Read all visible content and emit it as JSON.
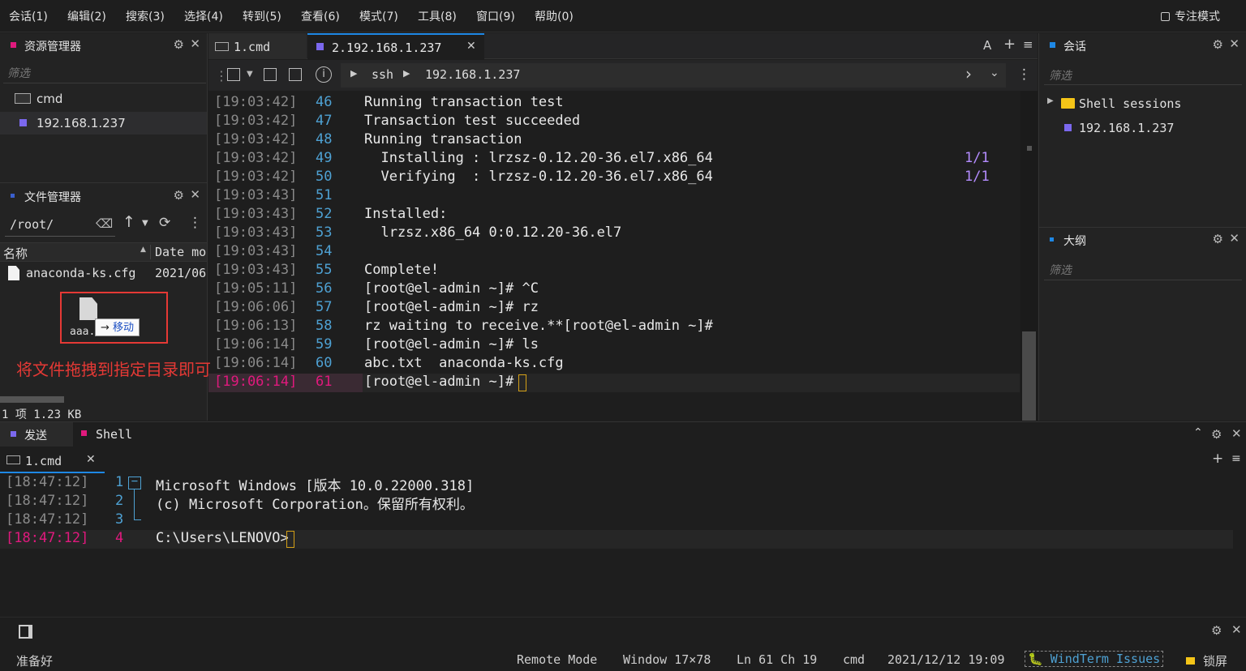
{
  "menu": [
    "会话(1)",
    "编辑(2)",
    "搜索(3)",
    "选择(4)",
    "转到(5)",
    "查看(6)",
    "模式(7)",
    "工具(8)",
    "窗口(9)",
    "帮助(0)"
  ],
  "focus_mode": "专注模式",
  "resource_panel": {
    "title": "资源管理器",
    "filter": "筛选",
    "items": [
      "cmd",
      "192.168.1.237"
    ]
  },
  "file_panel": {
    "title": "文件管理器",
    "path": "/root/",
    "col_name": "名称",
    "col_date": "Date mo",
    "row_name": "anaconda-ks.cfg",
    "row_date": "2021/06",
    "drag_label": "aaa.",
    "move_tip": "移动",
    "annotation": "将文件拖拽到指定目录即可",
    "footer": "1 项 1.23 KB"
  },
  "tabs": [
    "1.cmd",
    "2.192.168.1.237"
  ],
  "toolbar": {
    "proto": "ssh",
    "host": "192.168.1.237",
    "font_btn": "A"
  },
  "terminal_lines": [
    {
      "ts": "[19:03:42]",
      "ln": "46",
      "txt": "Running transaction test",
      "rt": ""
    },
    {
      "ts": "[19:03:42]",
      "ln": "47",
      "txt": "Transaction test succeeded",
      "rt": ""
    },
    {
      "ts": "[19:03:42]",
      "ln": "48",
      "txt": "Running transaction",
      "rt": ""
    },
    {
      "ts": "[19:03:42]",
      "ln": "49",
      "txt": "  Installing : lrzsz-0.12.20-36.el7.x86_64",
      "rt": "1/1"
    },
    {
      "ts": "[19:03:42]",
      "ln": "50",
      "txt": "  Verifying  : lrzsz-0.12.20-36.el7.x86_64",
      "rt": "1/1"
    },
    {
      "ts": "[19:03:43]",
      "ln": "51",
      "txt": "",
      "rt": ""
    },
    {
      "ts": "[19:03:43]",
      "ln": "52",
      "txt": "Installed:",
      "rt": ""
    },
    {
      "ts": "[19:03:43]",
      "ln": "53",
      "txt": "  lrzsz.x86_64 0:0.12.20-36.el7",
      "rt": ""
    },
    {
      "ts": "[19:03:43]",
      "ln": "54",
      "txt": "",
      "rt": ""
    },
    {
      "ts": "[19:03:43]",
      "ln": "55",
      "txt": "Complete!",
      "rt": ""
    },
    {
      "ts": "[19:05:11]",
      "ln": "56",
      "txt": "[root@el-admin ~]# ^C",
      "rt": ""
    },
    {
      "ts": "[19:06:06]",
      "ln": "57",
      "txt": "[root@el-admin ~]# rz",
      "rt": ""
    },
    {
      "ts": "[19:06:13]",
      "ln": "58",
      "txt": "rz waiting to receive.**[root@el-admin ~]#",
      "rt": ""
    },
    {
      "ts": "[19:06:14]",
      "ln": "59",
      "txt": "[root@el-admin ~]# ls",
      "rt": ""
    },
    {
      "ts": "[19:06:14]",
      "ln": "60",
      "txt": "abc.txt  anaconda-ks.cfg",
      "rt": ""
    },
    {
      "ts": "[19:06:14]",
      "ln": "61",
      "txt": "[root@el-admin ~]# ",
      "rt": ""
    }
  ],
  "session_panel": {
    "title": "会话",
    "filter": "筛选",
    "group": "Shell sessions",
    "item": "192.168.1.237"
  },
  "outline_panel": {
    "title": "大纲",
    "filter": "筛选"
  },
  "bottom_tabs": [
    "发送",
    "Shell"
  ],
  "bottom_subtab": "1.cmd",
  "bottom_lines": [
    {
      "ts": "[18:47:12]",
      "ln": "1",
      "txt": "Microsoft Windows [版本 10.0.22000.318]"
    },
    {
      "ts": "[18:47:12]",
      "ln": "2",
      "txt": "(c) Microsoft Corporation。保留所有权利。"
    },
    {
      "ts": "[18:47:12]",
      "ln": "3",
      "txt": ""
    },
    {
      "ts": "[18:47:12]",
      "ln": "4",
      "txt": "C:\\Users\\LENOVO>"
    }
  ],
  "status": {
    "ready": "准备好",
    "mode": "Remote Mode",
    "window": "Window 17×78",
    "pos": "Ln 61 Ch 19",
    "shell": "cmd",
    "datetime": "2021/12/12 19:09",
    "issues": "WindTerm Issues",
    "lock": "锁屏"
  },
  "colors": {
    "accent": "#1e88e5",
    "magenta": "#e0197d",
    "purple": "#7b68ee",
    "red_annot": "#e53935",
    "number_purple": "#b48cff",
    "line_blue": "#4ea1d3"
  }
}
